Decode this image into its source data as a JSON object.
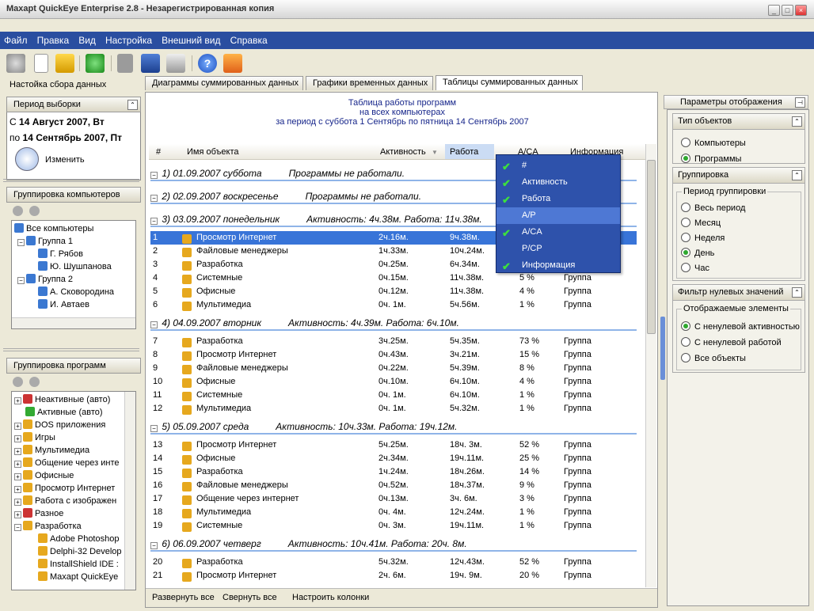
{
  "window": {
    "title": "Maxapt QuickEye Enterprise 2.8 - Незарегистрированная копия"
  },
  "menu": [
    "Файл",
    "Правка",
    "Вид",
    "Настройка",
    "Внешний вид",
    "Справка"
  ],
  "left": {
    "header": "Настойка сбора данных",
    "period": {
      "title": "Период выборки",
      "from_label": "С",
      "from": "14 Август 2007, Вт",
      "to_label": "по",
      "to": "14 Сентябрь 2007, Пт",
      "change": "Изменить"
    },
    "computers": {
      "title": "Группировка компьютеров",
      "items": [
        "Все компьютеры",
        "Группа 1",
        "Г. Рябов",
        "Ю. Шушпанова",
        "Группа 2",
        "А. Сковородина",
        "И. Автаев"
      ]
    },
    "programs": {
      "title": "Группировка программ",
      "items": [
        "Неактивные (авто)",
        "Активные (авто)",
        "DOS приложения",
        "Игры",
        "Мультимедиа",
        "Общение через инте",
        "Офисные",
        "Просмотр Интернет",
        "Работа с изображен",
        "Разное",
        "Разработка",
        "Adobe Photoshop",
        "Delphi-32 Develop",
        "InstallShield IDE :",
        "Maxapt QuickEye"
      ]
    }
  },
  "tabs": [
    "Диаграммы суммированных данных",
    "Графики временных данных",
    "Таблицы суммированных данных"
  ],
  "report": {
    "title1": "Таблица работы программ",
    "title2": "на всех компьютерах",
    "title3": "за период с суббота 1 Сентябрь по пятница 14 Сентябрь 2007",
    "columns": {
      "num": "#",
      "name": "Имя объекта",
      "activity": "Активность",
      "work": "Работа",
      "ac": "A/CA",
      "info": "Информация"
    },
    "groups": [
      {
        "label": "1) 01.09.2007 суббота",
        "summary": "Программы не работали.",
        "rows": []
      },
      {
        "label": "2) 02.09.2007 воскресенье",
        "summary": "Программы не работали.",
        "rows": []
      },
      {
        "label": "3) 03.09.2007 понедельник",
        "summary": "Активность:  4ч.38м.  Работа: 11ч.38м.",
        "rows": [
          {
            "n": "1",
            "name": "Просмотр Интернет",
            "act": "2ч.16м.",
            "work": "9ч.38м.",
            "ac": "",
            "info": ""
          },
          {
            "n": "2",
            "name": "Файловые менеджеры",
            "act": "1ч.33м.",
            "work": "10ч.24м.",
            "ac": "",
            "info": ""
          },
          {
            "n": "3",
            "name": "Разработка",
            "act": "0ч.25м.",
            "work": "6ч.34м.",
            "ac": "",
            "info": ""
          },
          {
            "n": "4",
            "name": "Системные",
            "act": "0ч.15м.",
            "work": "11ч.38м.",
            "ac": "5 %",
            "info": "Группа"
          },
          {
            "n": "5",
            "name": "Офисные",
            "act": "0ч.12м.",
            "work": "11ч.38м.",
            "ac": "4 %",
            "info": "Группа"
          },
          {
            "n": "6",
            "name": "Мультимедиа",
            "act": "0ч. 1м.",
            "work": "5ч.56м.",
            "ac": "1 %",
            "info": "Группа"
          }
        ]
      },
      {
        "label": "4) 04.09.2007 вторник",
        "summary": "Активность:  4ч.39м.  Работа:  6ч.10м.",
        "rows": [
          {
            "n": "7",
            "name": "Разработка",
            "act": "3ч.25м.",
            "work": "5ч.35м.",
            "ac": "73 %",
            "info": "Группа"
          },
          {
            "n": "8",
            "name": "Просмотр Интернет",
            "act": "0ч.43м.",
            "work": "3ч.21м.",
            "ac": "15 %",
            "info": "Группа"
          },
          {
            "n": "9",
            "name": "Файловые менеджеры",
            "act": "0ч.22м.",
            "work": "5ч.39м.",
            "ac": "8 %",
            "info": "Группа"
          },
          {
            "n": "10",
            "name": "Офисные",
            "act": "0ч.10м.",
            "work": "6ч.10м.",
            "ac": "4 %",
            "info": "Группа"
          },
          {
            "n": "11",
            "name": "Системные",
            "act": "0ч. 1м.",
            "work": "6ч.10м.",
            "ac": "1 %",
            "info": "Группа"
          },
          {
            "n": "12",
            "name": "Мультимедиа",
            "act": "0ч. 1м.",
            "work": "5ч.32м.",
            "ac": "1 %",
            "info": "Группа"
          }
        ]
      },
      {
        "label": "5) 05.09.2007 среда",
        "summary": "Активность: 10ч.33м.  Работа: 19ч.12м.",
        "rows": [
          {
            "n": "13",
            "name": "Просмотр Интернет",
            "act": "5ч.25м.",
            "work": "18ч. 3м.",
            "ac": "52 %",
            "info": "Группа"
          },
          {
            "n": "14",
            "name": "Офисные",
            "act": "2ч.34м.",
            "work": "19ч.11м.",
            "ac": "25 %",
            "info": "Группа"
          },
          {
            "n": "15",
            "name": "Разработка",
            "act": "1ч.24м.",
            "work": "18ч.26м.",
            "ac": "14 %",
            "info": "Группа"
          },
          {
            "n": "16",
            "name": "Файловые менеджеры",
            "act": "0ч.52м.",
            "work": "18ч.37м.",
            "ac": "9 %",
            "info": "Группа"
          },
          {
            "n": "17",
            "name": "Общение через интернет",
            "act": "0ч.13м.",
            "work": "3ч. 6м.",
            "ac": "3 %",
            "info": "Группа"
          },
          {
            "n": "18",
            "name": "Мультимедиа",
            "act": "0ч. 4м.",
            "work": "12ч.24м.",
            "ac": "1 %",
            "info": "Группа"
          },
          {
            "n": "19",
            "name": "Системные",
            "act": "0ч. 3м.",
            "work": "19ч.11м.",
            "ac": "1 %",
            "info": "Группа"
          }
        ]
      },
      {
        "label": "6) 06.09.2007 четверг",
        "summary": "Активность: 10ч.41м.  Работа: 20ч. 8м.",
        "rows": [
          {
            "n": "20",
            "name": "Разработка",
            "act": "5ч.32м.",
            "work": "12ч.43м.",
            "ac": "52 %",
            "info": "Группа"
          },
          {
            "n": "21",
            "name": "Просмотр Интернет",
            "act": "2ч. 6м.",
            "work": "19ч. 9м.",
            "ac": "20 %",
            "info": "Группа"
          }
        ]
      }
    ],
    "footer": [
      "Развернуть все",
      "Свернуть все",
      "Настроить колонки"
    ]
  },
  "popup": [
    {
      "label": "#",
      "checked": true
    },
    {
      "label": "Активность",
      "checked": true
    },
    {
      "label": "Работа",
      "checked": true
    },
    {
      "label": "A/P",
      "checked": false
    },
    {
      "label": "A/CA",
      "checked": true
    },
    {
      "label": "P/CP",
      "checked": false
    },
    {
      "label": "Информация",
      "checked": true
    }
  ],
  "right": {
    "header": "Параметры отображения",
    "type": {
      "title": "Тип объектов",
      "options": [
        "Компьютеры",
        "Программы"
      ],
      "selected": 1
    },
    "grouping": {
      "title": "Группировка",
      "legend": "Период группировки",
      "options": [
        "Весь период",
        "Месяц",
        "Неделя",
        "День",
        "Час"
      ],
      "selected": 3
    },
    "filter": {
      "title": "Фильтр нулевых значений",
      "legend": "Отображаемые элементы",
      "options": [
        "С ненулевой активностью",
        "С ненулевой работой",
        "Все объекты"
      ],
      "selected": 0
    }
  }
}
